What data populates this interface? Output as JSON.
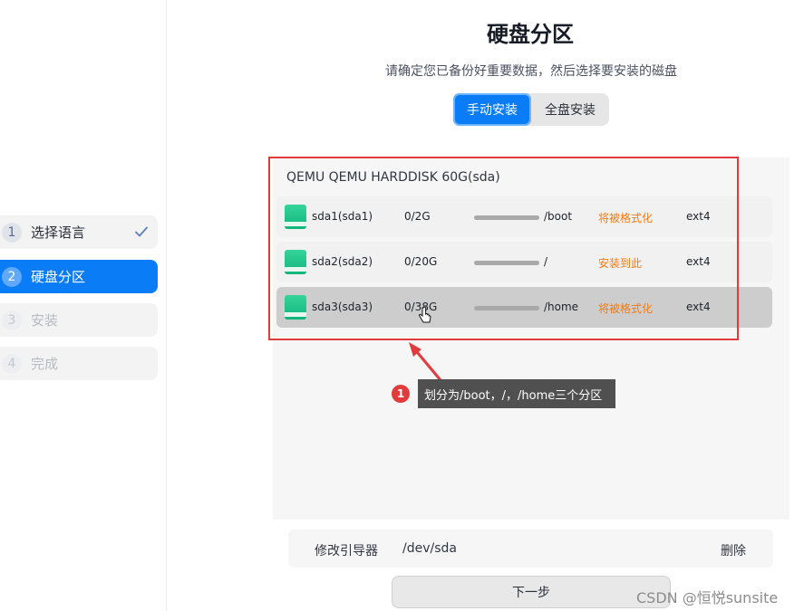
{
  "sidebar": {
    "steps": [
      {
        "num": "1",
        "label": "选择语言",
        "state": "done"
      },
      {
        "num": "2",
        "label": "硬盘分区",
        "state": "active"
      },
      {
        "num": "3",
        "label": "安装",
        "state": "disabled"
      },
      {
        "num": "4",
        "label": "完成",
        "state": "disabled"
      }
    ]
  },
  "header": {
    "title": "硬盘分区",
    "subtitle": "请确定您已备份好重要数据，然后选择要安装的磁盘"
  },
  "mode": {
    "manual_label": "手动安装",
    "full_label": "全盘安装",
    "selected": "manual"
  },
  "disk": {
    "name": "QEMU QEMU HARDDISK 60G(sda)",
    "partitions": [
      {
        "name": "sda1(sda1)",
        "size": "0/2G",
        "usage": 0,
        "mount": "/boot",
        "action": "将被格式化",
        "fs": "ext4"
      },
      {
        "name": "sda2(sda2)",
        "size": "0/20G",
        "usage": 0,
        "mount": "/",
        "action": "安装到此",
        "fs": "ext4"
      },
      {
        "name": "sda3(sda3)",
        "size": "0/38G",
        "usage": 0,
        "mount": "/home",
        "action": "将被格式化",
        "fs": "ext4"
      }
    ]
  },
  "annotation": {
    "badge": "1",
    "text": "划分为/boot，/，/home三个分区",
    "color": "#e23b3b"
  },
  "bootloader": {
    "label": "修改引导器",
    "device": "/dev/sda",
    "delete_label": "删除"
  },
  "next_label": "下一步",
  "watermark": "CSDN @恒悦sunsite",
  "colors": {
    "accent": "#0a7cf5",
    "warning": "#f27a12"
  }
}
